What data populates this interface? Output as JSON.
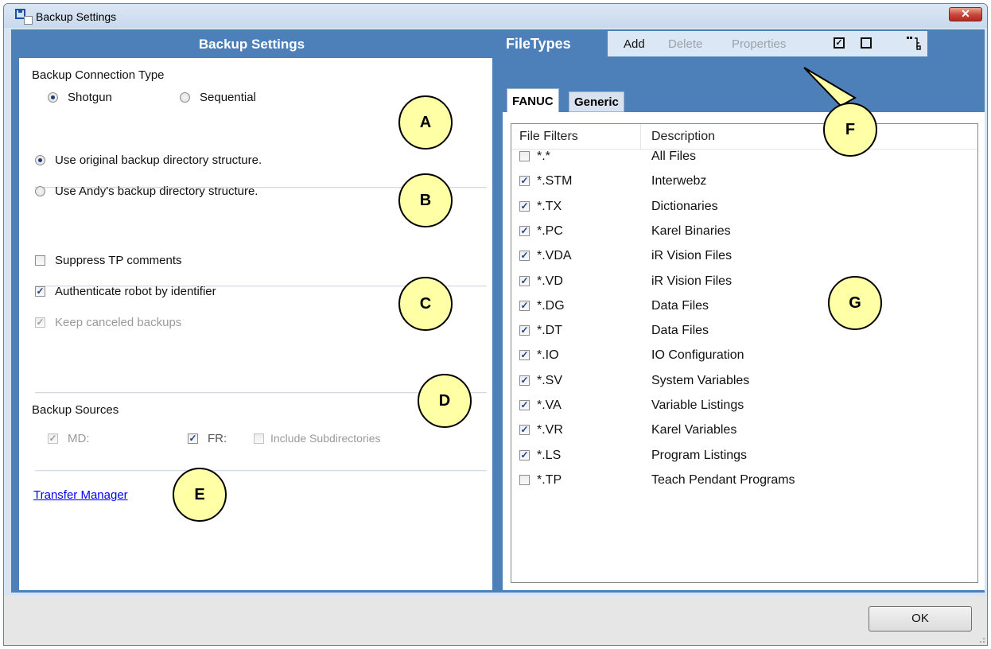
{
  "window": {
    "title": "Backup Settings",
    "close_label": "✕"
  },
  "left": {
    "header": "Backup Settings",
    "connection": {
      "label": "Backup Connection Type",
      "options": [
        "Shotgun",
        "Sequential"
      ],
      "selected": "Shotgun"
    },
    "structure": {
      "options": [
        "Use original backup directory structure.",
        "Use Andy's backup directory structure."
      ],
      "selected": "Use original backup directory structure."
    },
    "options": [
      {
        "label": "Suppress TP comments",
        "checked": false,
        "enabled": true
      },
      {
        "label": "Authenticate robot by identifier",
        "checked": true,
        "enabled": true
      },
      {
        "label": "Keep canceled backups",
        "checked": true,
        "enabled": false
      }
    ],
    "sources": {
      "label": "Backup Sources",
      "items": [
        {
          "label": "MD:",
          "checked": true,
          "enabled": false
        },
        {
          "label": "FR:",
          "checked": true,
          "enabled": true
        },
        {
          "label": "Include Subdirectories",
          "checked": false,
          "enabled": false
        }
      ]
    },
    "link": "Transfer Manager"
  },
  "filetypes": {
    "title": "FileTypes",
    "toolbar": {
      "add": "Add",
      "delete": "Delete",
      "properties": "Properties",
      "check_all_glyph": "✓"
    },
    "tabs": [
      "FANUC",
      "Generic"
    ],
    "active_tab": "FANUC",
    "columns": [
      "File Filters",
      "Description"
    ],
    "rows": [
      {
        "filter": "*.*",
        "desc": "All Files",
        "checked": false
      },
      {
        "filter": "*.STM",
        "desc": "Interwebz",
        "checked": true
      },
      {
        "filter": "*.TX",
        "desc": "Dictionaries",
        "checked": true
      },
      {
        "filter": "*.PC",
        "desc": "Karel Binaries",
        "checked": true
      },
      {
        "filter": "*.VDA",
        "desc": "iR Vision Files",
        "checked": true
      },
      {
        "filter": "*.VD",
        "desc": "iR Vision Files",
        "checked": true
      },
      {
        "filter": "*.DG",
        "desc": "Data Files",
        "checked": true
      },
      {
        "filter": "*.DT",
        "desc": "Data Files",
        "checked": true
      },
      {
        "filter": "*.IO",
        "desc": "IO Configuration",
        "checked": true
      },
      {
        "filter": "*.SV",
        "desc": "System Variables",
        "checked": true
      },
      {
        "filter": "*.VA",
        "desc": "Variable Listings",
        "checked": true
      },
      {
        "filter": "*.VR",
        "desc": "Karel Variables",
        "checked": true
      },
      {
        "filter": "*.LS",
        "desc": "Program Listings",
        "checked": true
      },
      {
        "filter": "*.TP",
        "desc": "Teach Pendant Programs",
        "checked": false
      }
    ]
  },
  "callouts": [
    "A",
    "B",
    "C",
    "D",
    "E",
    "F",
    "G"
  ],
  "ok_label": "OK",
  "colors": {
    "header_blue": "#4d80b9",
    "callout_fill": "#ffffa6",
    "link": "#0000ee"
  }
}
